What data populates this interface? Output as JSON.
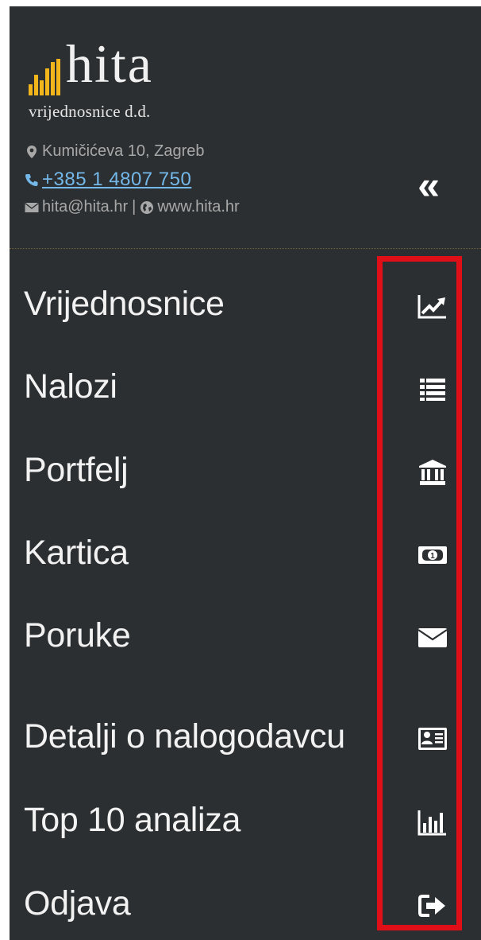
{
  "brand": {
    "logo_text": "hita",
    "subtitle": "vrijednosnice d.d."
  },
  "contact": {
    "address": "Kumičićeva 10, Zagreb",
    "phone": "+385 1 4807 750",
    "email": "hita@hita.hr",
    "separator": "|",
    "website": "www.hita.hr"
  },
  "collapse": {
    "label": "«"
  },
  "menu": {
    "items": [
      {
        "label": "Vrijednosnice",
        "icon": "chart-line-icon"
      },
      {
        "label": "Nalozi",
        "icon": "list-icon"
      },
      {
        "label": "Portfelj",
        "icon": "bank-icon"
      },
      {
        "label": "Kartica",
        "icon": "money-icon"
      },
      {
        "label": "Poruke",
        "icon": "envelope-icon"
      },
      {
        "label": "Detalji o nalogodavcu",
        "icon": "id-card-icon"
      },
      {
        "label": "Top 10 analiza",
        "icon": "bar-chart-icon"
      },
      {
        "label": "Odjava",
        "icon": "sign-out-icon"
      }
    ]
  },
  "colors": {
    "sidebar_background": "#2c2f31",
    "logo_accent": "#f2b51c",
    "link": "#74b8ea",
    "highlight": "#e00f17",
    "text": "#f2f2f2"
  }
}
